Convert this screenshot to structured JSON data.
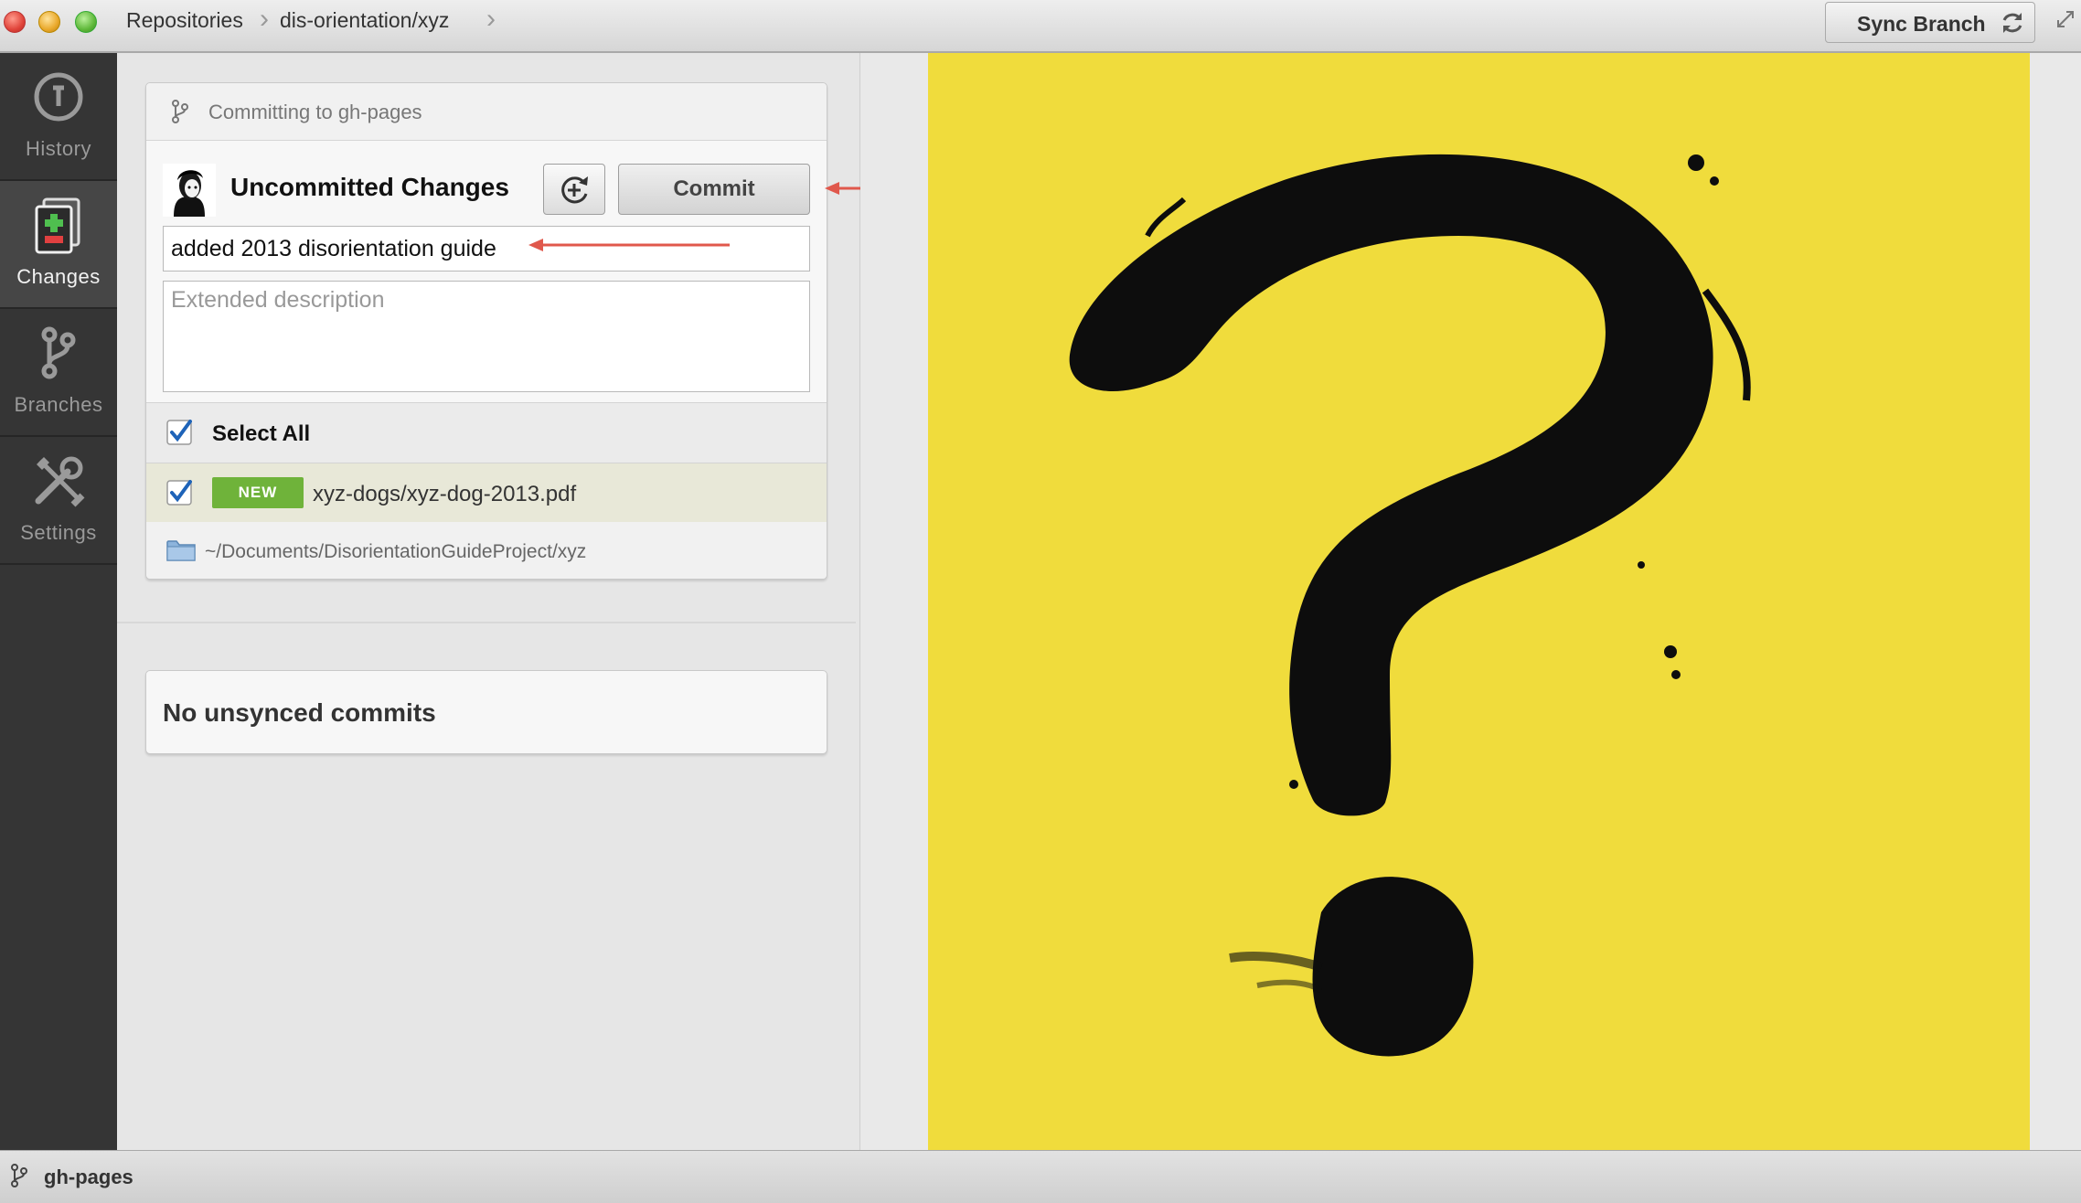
{
  "titlebar": {
    "breadcrumb": [
      "Repositories",
      "dis-orientation/xyz"
    ],
    "sync_label": "Sync Branch"
  },
  "sidebar": {
    "items": [
      {
        "label": "History",
        "icon": "history-icon",
        "active": false
      },
      {
        "label": "Changes",
        "icon": "changes-icon",
        "active": true
      },
      {
        "label": "Branches",
        "icon": "branches-icon",
        "active": false
      },
      {
        "label": "Settings",
        "icon": "settings-icon",
        "active": false
      }
    ]
  },
  "commit": {
    "header": "Committing to gh-pages",
    "title": "Uncommitted Changes",
    "commit_label": "Commit",
    "summary_value": "added 2013 disorientation guide",
    "description_placeholder": "Extended description",
    "select_all_label": "Select All",
    "files": [
      {
        "status": "NEW",
        "path": "xyz-dogs/xyz-dog-2013.pdf",
        "checked": true
      }
    ],
    "repo_path": "~/Documents/DisorientationGuideProject/xyz"
  },
  "unsynced": {
    "text": "No unsynced commits"
  },
  "statusbar": {
    "branch": "gh-pages"
  },
  "colors": {
    "sidebar_bg": "#353535",
    "poster_yellow": "#f0dc3c",
    "new_badge": "#6fb33a",
    "annotation_arrow": "#e0584c",
    "checkbox_blue": "#1e63b8"
  }
}
